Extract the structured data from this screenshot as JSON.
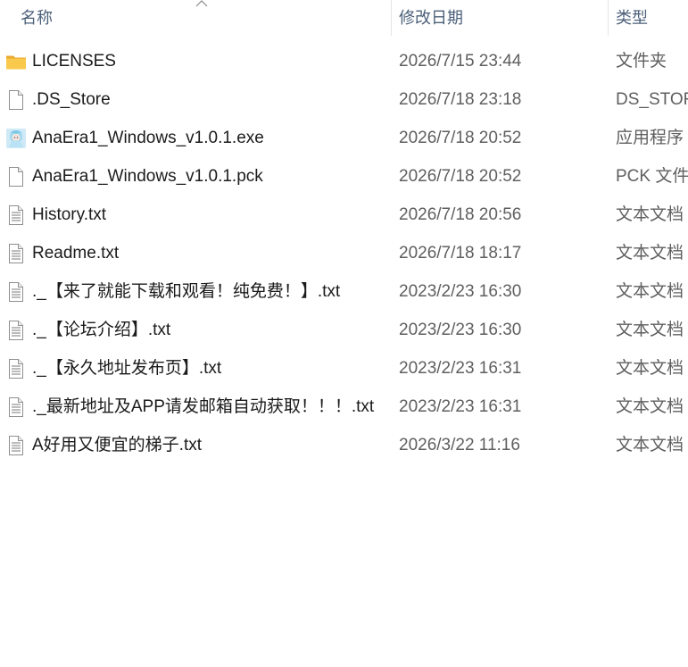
{
  "columns": {
    "name": "名称",
    "date_modified": "修改日期",
    "type": "类型"
  },
  "sort": {
    "column": "name",
    "direction": "ascending",
    "icon": "chevron-up-icon"
  },
  "files": [
    {
      "name": "LICENSES",
      "date": "2026/7/15 23:44",
      "type": "文件夹",
      "icon": "folder-icon"
    },
    {
      "name": ".DS_Store",
      "date": "2026/7/18 23:18",
      "type": "DS_STORE",
      "icon": "blank-file-icon"
    },
    {
      "name": "AnaEra1_Windows_v1.0.1.exe",
      "date": "2026/7/18 20:52",
      "type": "应用程序",
      "icon": "app-icon"
    },
    {
      "name": "AnaEra1_Windows_v1.0.1.pck",
      "date": "2026/7/18 20:52",
      "type": "PCK 文件",
      "icon": "blank-file-icon"
    },
    {
      "name": "History.txt",
      "date": "2026/7/18 20:56",
      "type": "文本文档",
      "icon": "text-file-icon"
    },
    {
      "name": "Readme.txt",
      "date": "2026/7/18 18:17",
      "type": "文本文档",
      "icon": "text-file-icon"
    },
    {
      "name": "._【来了就能下载和观看！纯免费！】.txt",
      "date": "2023/2/23 16:30",
      "type": "文本文档",
      "icon": "text-file-icon"
    },
    {
      "name": "._【论坛介绍】.txt",
      "date": "2023/2/23 16:30",
      "type": "文本文档",
      "icon": "text-file-icon"
    },
    {
      "name": "._【永久地址发布页】.txt",
      "date": "2023/2/23 16:31",
      "type": "文本文档",
      "icon": "text-file-icon"
    },
    {
      "name": "._最新地址及APP请发邮箱自动获取！！！.txt",
      "date": "2023/2/23 16:31",
      "type": "文本文档",
      "icon": "text-file-icon"
    },
    {
      "name": "A好用又便宜的梯子.txt",
      "date": "2026/3/22 11:16",
      "type": "文本文档",
      "icon": "text-file-icon"
    }
  ],
  "colors": {
    "header_text": "#4c607a",
    "name_text": "#1b1b1b",
    "meta_text": "#5f5f5f",
    "folder": "#f5c242"
  }
}
